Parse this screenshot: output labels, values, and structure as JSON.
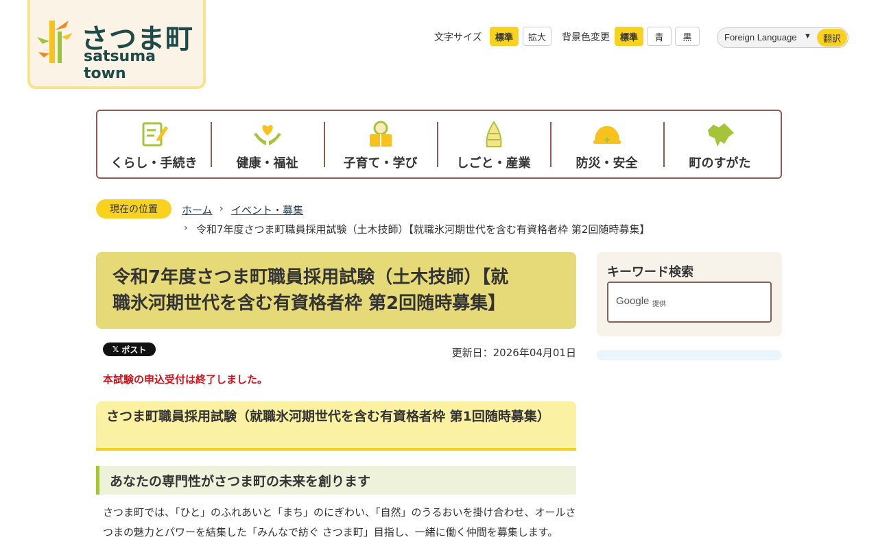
{
  "logo": {
    "jp": "さつま町",
    "en": "satsuma town"
  },
  "header": {
    "font_size_label": "文字サイズ",
    "font_standard": "標準",
    "font_large": "拡大",
    "bg_label": "背景色変更",
    "bg_standard": "標準",
    "bg_blue": "青",
    "bg_black": "黒",
    "language_select": "Foreign Language",
    "translate_button": "翻訳"
  },
  "nav": [
    {
      "label": "くらし・手続き",
      "icon": "document-pen-icon"
    },
    {
      "label": "健康・福祉",
      "icon": "hands-heart-icon"
    },
    {
      "label": "子育て・学び",
      "icon": "child-reading-icon"
    },
    {
      "label": "しごと・産業",
      "icon": "bamboo-shoot-icon"
    },
    {
      "label": "防災・安全",
      "icon": "helmet-icon"
    },
    {
      "label": "町のすがた",
      "icon": "town-map-icon"
    }
  ],
  "breadcrumb": {
    "badge": "現在の位置",
    "home": "ホーム",
    "category": "イベント・募集",
    "current": "令和7年度さつま町職員採用試験（土木技師）【就職氷河期世代を含む有資格者枠 第2回随時募集】"
  },
  "article": {
    "title_line1": "令和7年度さつま町職員採用試験（土木技師）【就",
    "title_line2": "職氷河期世代を含む有資格者枠 第2回随時募集】",
    "post_button": "ポスト",
    "updated": "更新日：2026年04月01日",
    "notice": "本試験の申込受付は終了しました。",
    "heading2": "さつま町職員採用試験（就職氷河期世代を含む有資格者枠 第1回随時募集）",
    "heading3": "あなたの専門性がさつま町の未来を創ります",
    "body": "さつま町では、「ひと」のふれあいと「まち」のにぎわい、「自然」のうるおいを掛け合わせ、オールさつまの魅力とパワーを結集した「みんなで紡ぐ さつま町」目指し、一緒に働く仲間を募集します。"
  },
  "sidebar": {
    "search_title": "キーワード検索",
    "google": "Google",
    "google_sub": "提供"
  },
  "colors": {
    "accent_yellow": "#f7d21e",
    "nav_border": "#8b5d55",
    "title_bg": "#e6d977",
    "notice_red": "#d0121b"
  }
}
